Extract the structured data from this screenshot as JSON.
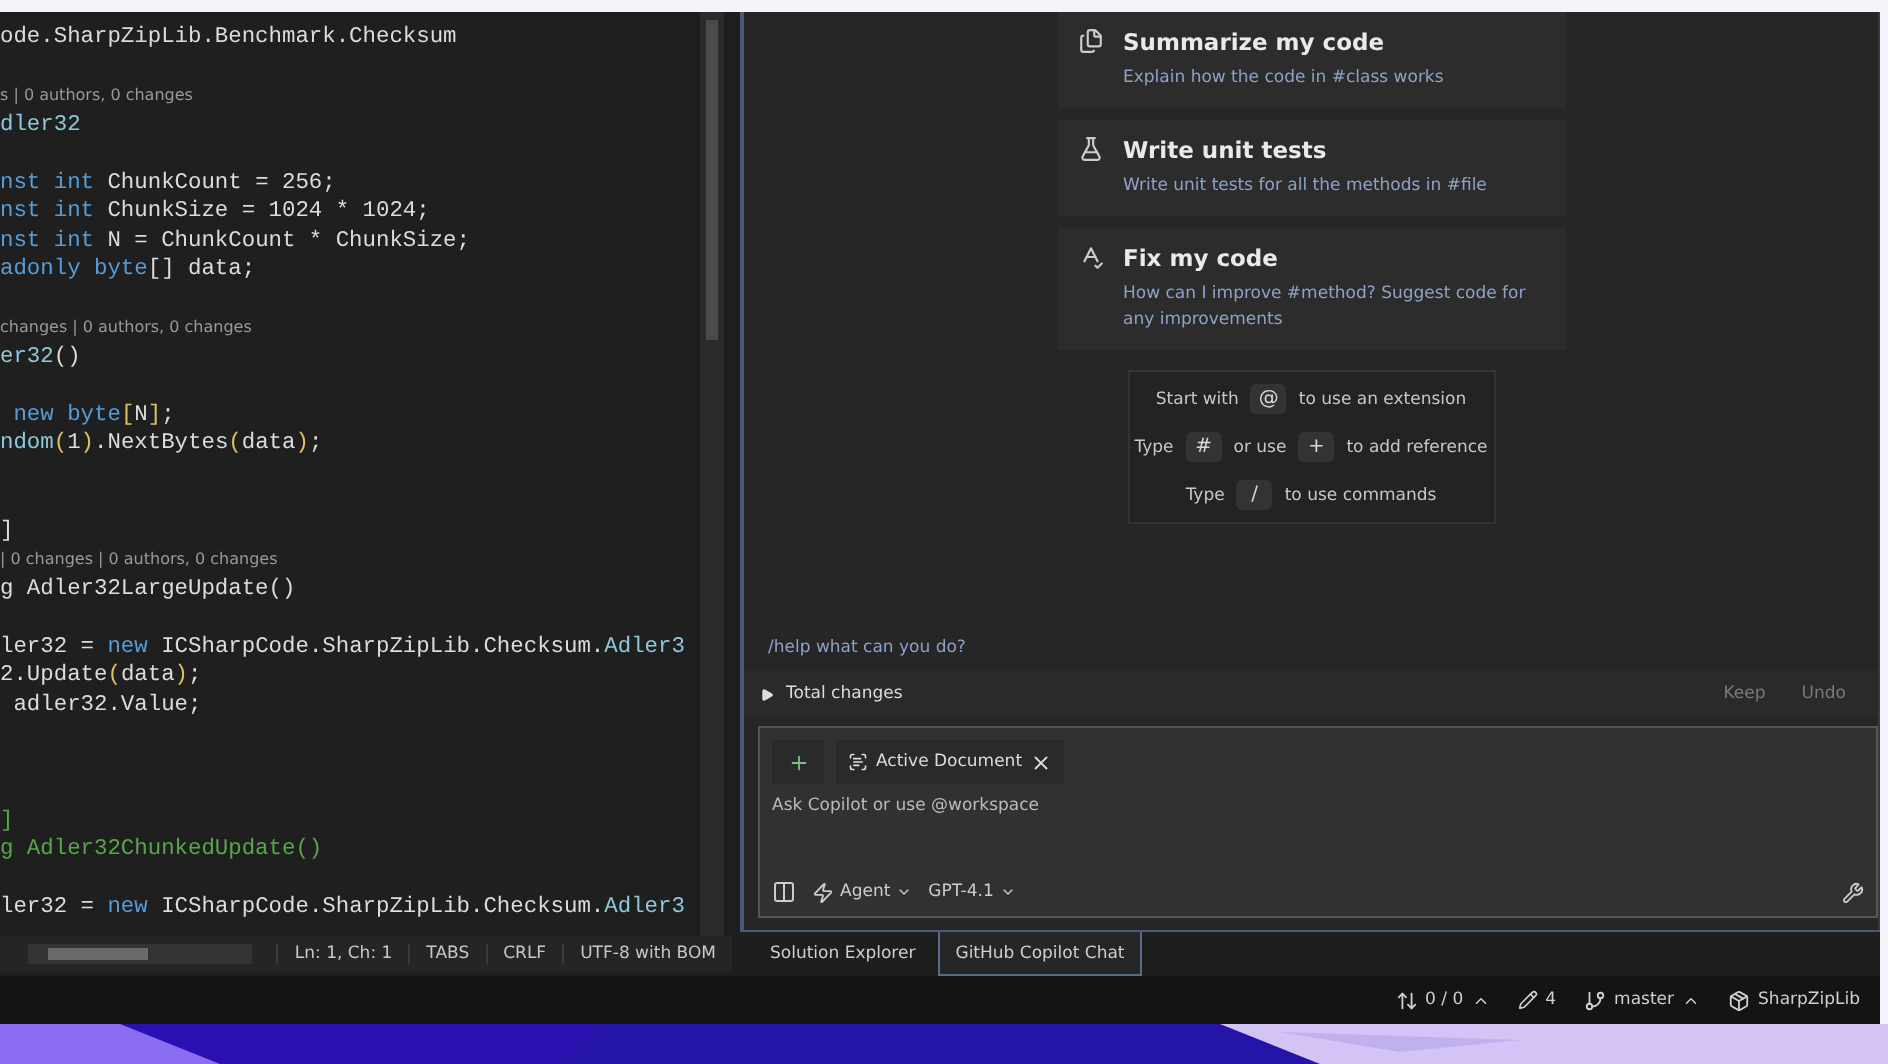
{
  "editor": {
    "lines": [
      {
        "kind": "code",
        "tokens": [
          {
            "kind": "plain",
            "text": "ode.SharpZipLib.Benchmark.Checksum"
          }
        ]
      },
      {
        "kind": "blank"
      },
      {
        "kind": "lens",
        "text": "s | 0 authors, 0 changes"
      },
      {
        "kind": "code",
        "tokens": [
          {
            "kind": "type",
            "text": "dler32"
          }
        ]
      },
      {
        "kind": "blank"
      },
      {
        "kind": "code",
        "tokens": [
          {
            "kind": "kw",
            "text": "nst int"
          },
          {
            "kind": "plain",
            "text": " ChunkCount = 256;"
          }
        ]
      },
      {
        "kind": "code",
        "tokens": [
          {
            "kind": "kw",
            "text": "nst int"
          },
          {
            "kind": "plain",
            "text": " ChunkSize = 1024 * 1024;"
          }
        ]
      },
      {
        "kind": "code",
        "tokens": [
          {
            "kind": "kw",
            "text": "nst int"
          },
          {
            "kind": "plain",
            "text": " N = ChunkCount * ChunkSize;"
          }
        ]
      },
      {
        "kind": "code",
        "tokens": [
          {
            "kind": "kw",
            "text": "adonly byte"
          },
          {
            "kind": "plain",
            "text": "[] data;"
          }
        ]
      },
      {
        "kind": "blank"
      },
      {
        "kind": "lens",
        "text": "changes | 0 authors, 0 changes"
      },
      {
        "kind": "code",
        "tokens": [
          {
            "kind": "type",
            "text": "er32"
          },
          {
            "kind": "plain",
            "text": "()"
          }
        ]
      },
      {
        "kind": "blank"
      },
      {
        "kind": "code",
        "tokens": [
          {
            "kind": "kw",
            "text": " new byte"
          },
          {
            "kind": "bracket",
            "text": "["
          },
          {
            "kind": "plain",
            "text": "N"
          },
          {
            "kind": "bracket",
            "text": "]"
          },
          {
            "kind": "plain",
            "text": ";"
          }
        ]
      },
      {
        "kind": "code",
        "tokens": [
          {
            "kind": "type",
            "text": "ndom"
          },
          {
            "kind": "bracket",
            "text": "("
          },
          {
            "kind": "plain",
            "text": "1"
          },
          {
            "kind": "bracket",
            "text": ")"
          },
          {
            "kind": "plain",
            "text": ".NextBytes"
          },
          {
            "kind": "bracket",
            "text": "("
          },
          {
            "kind": "plain",
            "text": "data"
          },
          {
            "kind": "bracket",
            "text": ")"
          },
          {
            "kind": "plain",
            "text": ";"
          }
        ]
      },
      {
        "kind": "blank"
      },
      {
        "kind": "blank"
      },
      {
        "kind": "code",
        "tokens": [
          {
            "kind": "plain",
            "text": "]"
          }
        ]
      },
      {
        "kind": "lens",
        "text": "| 0 changes | 0 authors, 0 changes"
      },
      {
        "kind": "code",
        "tokens": [
          {
            "kind": "plain",
            "text": "g Adler32LargeUpdate()"
          }
        ]
      },
      {
        "kind": "blank"
      },
      {
        "kind": "code",
        "tokens": [
          {
            "kind": "plain",
            "text": "ler32 = "
          },
          {
            "kind": "kw",
            "text": "new"
          },
          {
            "kind": "plain",
            "text": " ICSharpCode.SharpZipLib.Checksum."
          },
          {
            "kind": "type",
            "text": "Adler3"
          }
        ]
      },
      {
        "kind": "code",
        "tokens": [
          {
            "kind": "plain",
            "text": "2.Update"
          },
          {
            "kind": "bracket",
            "text": "("
          },
          {
            "kind": "plain",
            "text": "data"
          },
          {
            "kind": "bracket",
            "text": ")"
          },
          {
            "kind": "plain",
            "text": ";"
          }
        ]
      },
      {
        "kind": "code",
        "tokens": [
          {
            "kind": "plain",
            "text": " adler32.Value;"
          }
        ]
      },
      {
        "kind": "blank"
      },
      {
        "kind": "blank"
      },
      {
        "kind": "blank"
      },
      {
        "kind": "code",
        "tokens": [
          {
            "kind": "comment",
            "text": "]"
          }
        ]
      },
      {
        "kind": "code",
        "tokens": [
          {
            "kind": "comment",
            "text": "g Adler32ChunkedUpdate()"
          }
        ]
      },
      {
        "kind": "blank"
      },
      {
        "kind": "code",
        "tokens": [
          {
            "kind": "plain",
            "text": "ler32 = "
          },
          {
            "kind": "kw",
            "text": "new"
          },
          {
            "kind": "plain",
            "text": " ICSharpCode.SharpZipLib.Checksum."
          },
          {
            "kind": "type",
            "text": "Adler3"
          }
        ]
      }
    ],
    "status": [
      "Ln: 1, Ch: 1",
      "TABS",
      "CRLF",
      "UTF-8 with BOM"
    ]
  },
  "chat": {
    "suggestions": [
      {
        "kind": "summarize",
        "title": "Summarize my code",
        "description": "Explain how the code in #class works"
      },
      {
        "kind": "tests",
        "title": "Write unit tests",
        "description": "Write unit tests for all the methods in #file"
      },
      {
        "kind": "fix",
        "title": "Fix my code",
        "description": "How can I improve #method? Suggest code for any improvements"
      }
    ],
    "hints": [
      [
        {
          "kind": "text",
          "text": "Start with"
        },
        {
          "kind": "key",
          "text": "@"
        },
        {
          "kind": "text",
          "text": "to use an extension"
        }
      ],
      [
        {
          "kind": "text",
          "text": "Type"
        },
        {
          "kind": "key",
          "text": "#"
        },
        {
          "kind": "text",
          "text": "or use"
        },
        {
          "kind": "key",
          "text": "+"
        },
        {
          "kind": "text",
          "text": "to add reference"
        }
      ],
      [
        {
          "kind": "text",
          "text": "Type"
        },
        {
          "kind": "key",
          "text": "/"
        },
        {
          "kind": "text",
          "text": "to use commands"
        }
      ]
    ],
    "help_prompt": "/help what can you do?",
    "changes": {
      "label": "Total changes",
      "expanded": false,
      "actions": [
        {
          "label": "Keep",
          "disabled": true
        },
        {
          "label": "Undo",
          "disabled": true
        }
      ]
    },
    "input": {
      "chips": [
        {
          "label": "Active Document"
        }
      ],
      "placeholder": "Ask Copilot or use @workspace",
      "mode": "Agent",
      "model": "GPT-4.1"
    }
  },
  "tool_tabs": [
    {
      "label": "Solution Explorer",
      "selected": false
    },
    {
      "label": "GitHub Copilot Chat",
      "selected": true
    }
  ],
  "status_bar": {
    "sync": "0 / 0",
    "edits": "4",
    "branch": "master",
    "repo": "SharpZipLib"
  }
}
